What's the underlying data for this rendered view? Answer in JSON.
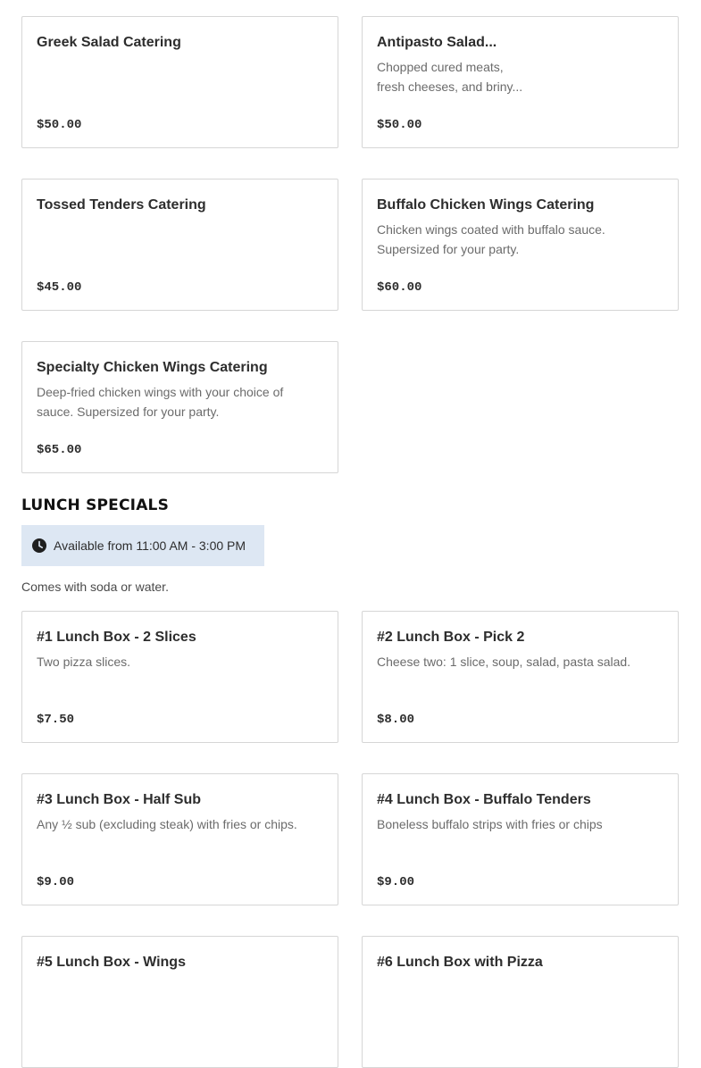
{
  "catering_items": [
    {
      "title": "Greek Salad Catering",
      "description": "",
      "price": "$50.00"
    },
    {
      "title": "Antipasto Salad...",
      "description": "Chopped cured meats, fresh cheeses, and briny...",
      "price": "$50.00"
    },
    {
      "title": "Tossed Tenders Catering",
      "description": "",
      "price": "$45.00"
    },
    {
      "title": "Buffalo Chicken Wings Catering",
      "description": "Chicken wings coated with buffalo sauce. Supersized for your party.",
      "price": "$60.00"
    },
    {
      "title": "Specialty Chicken Wings Catering",
      "description": "Deep-fried chicken wings with your choice of sauce. Supersized for your party.",
      "price": "$65.00"
    }
  ],
  "lunch_specials": {
    "heading": "LUNCH SPECIALS",
    "availability": "Available from 11:00 AM - 3:00 PM",
    "availability_icon": "clock-icon",
    "note": "Comes with soda or water.",
    "items": [
      {
        "title": "#1 Lunch Box - 2 Slices",
        "description": "Two pizza slices.",
        "price": "$7.50"
      },
      {
        "title": "#2 Lunch Box - Pick 2",
        "description": "Cheese two: 1 slice, soup, salad, pasta salad.",
        "price": "$8.00"
      },
      {
        "title": "#3 Lunch Box - Half Sub",
        "description": "Any ½ sub (excluding steak) with fries or chips.",
        "price": "$9.00"
      },
      {
        "title": "#4 Lunch Box - Buffalo Tenders",
        "description": "Boneless buffalo strips with fries or chips",
        "price": "$9.00"
      },
      {
        "title": "#5 Lunch Box - Wings",
        "description": "",
        "price": ""
      },
      {
        "title": "#6 Lunch Box with Pizza",
        "description": "",
        "price": ""
      }
    ]
  },
  "colors": {
    "availability_background": "#dde7f3",
    "card_border": "#d6d6d6",
    "description_text": "#6b6b6b"
  }
}
